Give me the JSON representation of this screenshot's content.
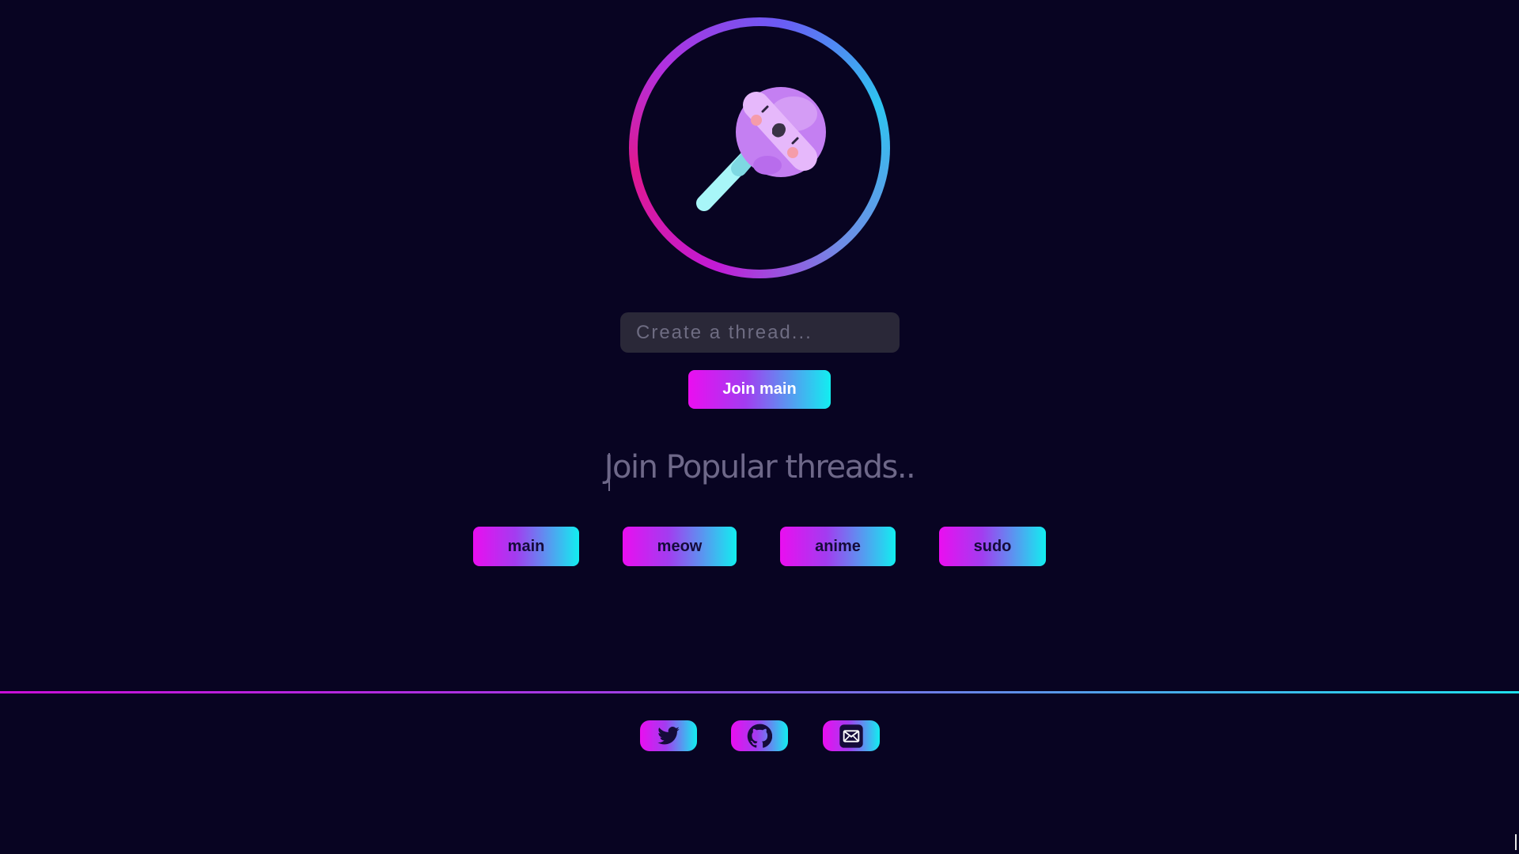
{
  "logo": {
    "icon": "lollipop-icon",
    "ring_colors": [
      "#c21bd6",
      "#e0188f",
      "#6a5cf5",
      "#2ec5f0"
    ]
  },
  "thread_form": {
    "placeholder": "Create a thread...",
    "value": "",
    "join_label": "Join main"
  },
  "popular": {
    "title": "Join Popular threads..",
    "threads": [
      {
        "label": "main"
      },
      {
        "label": "meow"
      },
      {
        "label": "anime"
      },
      {
        "label": "sudo"
      }
    ]
  },
  "footer": {
    "links": [
      {
        "icon": "twitter-icon"
      },
      {
        "icon": "github-icon"
      },
      {
        "icon": "mail-icon"
      }
    ]
  },
  "colors": {
    "background": "#080422",
    "gradient_start": "#ea0ef0",
    "gradient_end": "#12eef0",
    "input_bg": "#2a2838",
    "heading": "#6e6889"
  }
}
